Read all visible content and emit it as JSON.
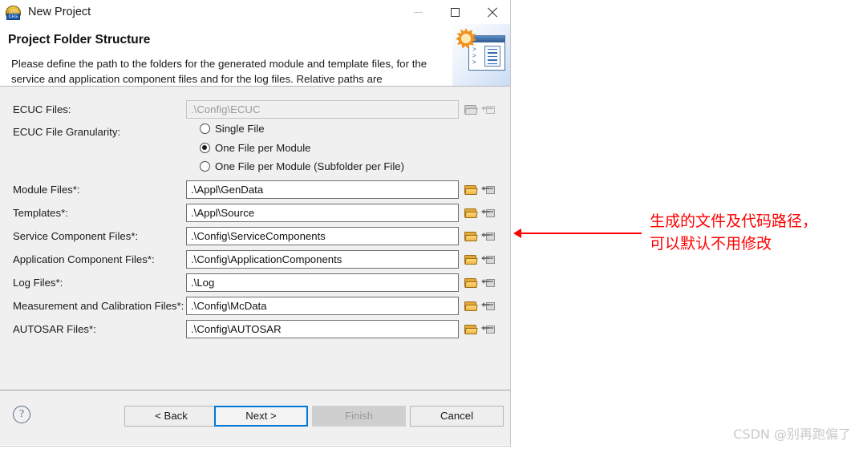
{
  "window": {
    "title": "New Project",
    "icon": "cfg-dome-icon",
    "controls": {
      "minimize": "minimize-icon",
      "maximize": "maximize-icon",
      "close": "close-icon"
    }
  },
  "header": {
    "title": "Project Folder Structure",
    "description": "Please define the path to the folders for the generated module and template files, for the service and application component files and for the log files. Relative paths are",
    "banner_icon": "wizard-window-icon"
  },
  "form": {
    "ecuc_files": {
      "label": "ECUC Files:",
      "value": ".\\Config\\ECUC",
      "disabled": true
    },
    "granularity": {
      "label": "ECUC File Granularity:",
      "options": [
        {
          "label": "Single File",
          "selected": false
        },
        {
          "label": "One File per Module",
          "selected": true
        },
        {
          "label": "One File per Module (Subfolder per File)",
          "selected": false
        }
      ]
    },
    "rows": [
      {
        "label": "Module Files*:",
        "value": ".\\Appl\\GenData"
      },
      {
        "label": "Templates*:",
        "value": ".\\Appl\\Source"
      },
      {
        "label": "Service Component Files*:",
        "value": ".\\Config\\ServiceComponents"
      },
      {
        "label": "Application Component Files*:",
        "value": ".\\Config\\ApplicationComponents"
      },
      {
        "label": "Log Files*:",
        "value": ".\\Log"
      },
      {
        "label": "Measurement and Calibration Files*:",
        "value": ".\\Config\\McData"
      },
      {
        "label": "AUTOSAR Files*:",
        "value": ".\\Config\\AUTOSAR"
      }
    ],
    "browse_icon": "folder-browse-icon",
    "variables_icon": "variables-browse-icon"
  },
  "footer": {
    "help": "?",
    "back": "< Back",
    "next": "Next >",
    "finish": "Finish",
    "cancel": "Cancel"
  },
  "annotation": {
    "text": "生成的文件及代码路径，\n可以默认不用修改",
    "color": "#ff0000"
  },
  "watermark": {
    "text": "CSDN @别再跑偏了"
  }
}
